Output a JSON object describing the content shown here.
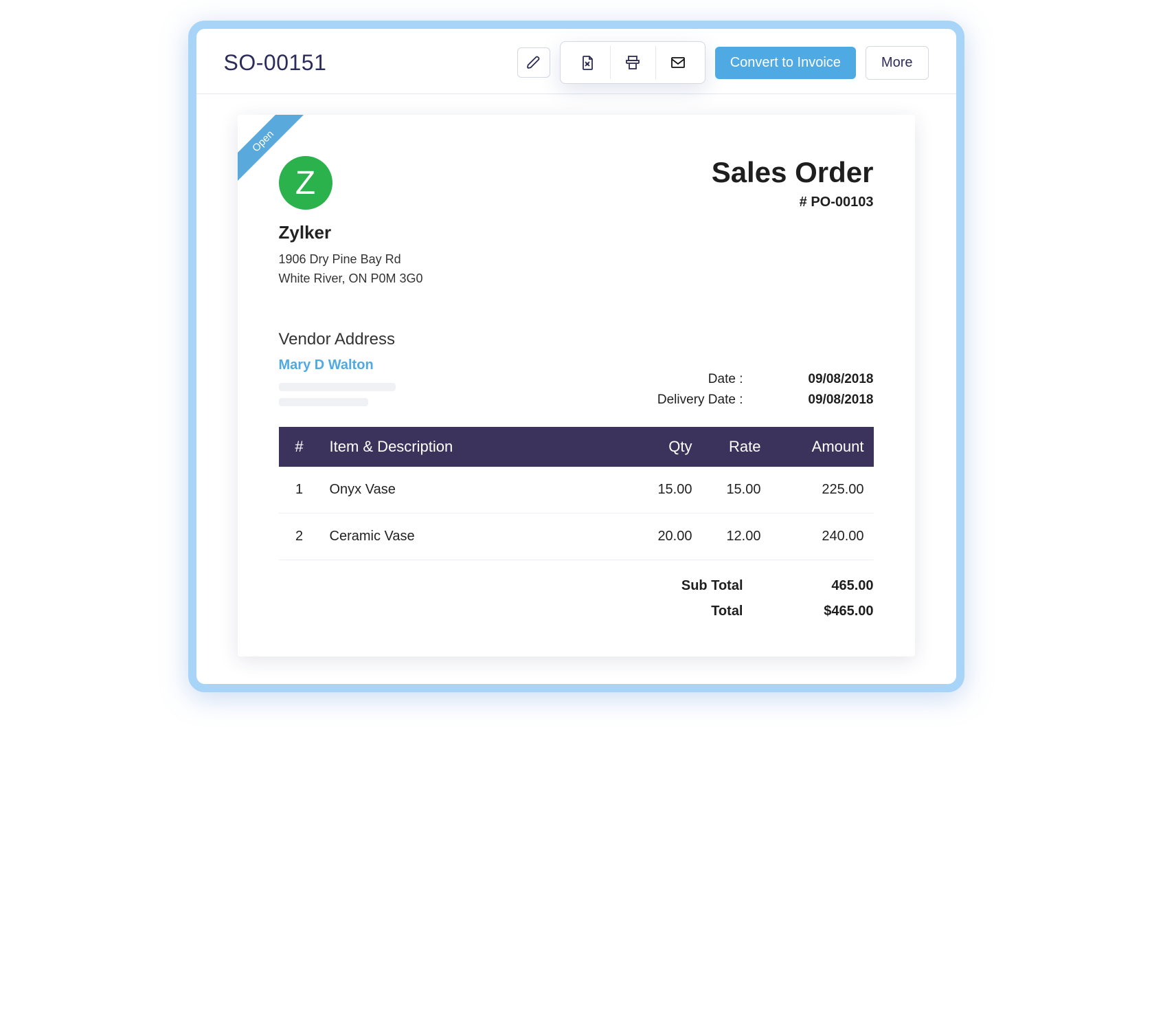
{
  "header": {
    "order_id": "SO-00151",
    "convert_label": "Convert to Invoice",
    "more_label": "More"
  },
  "ribbon": {
    "status": "Open"
  },
  "company": {
    "logo_letter": "Z",
    "name": "Zylker",
    "address_line1": "1906 Dry Pine Bay Rd",
    "address_line2": "White River, ON P0M 3G0"
  },
  "document": {
    "type_label": "Sales Order",
    "number": "# PO-00103"
  },
  "vendor": {
    "heading": "Vendor Address",
    "name": "Mary D Walton"
  },
  "meta": {
    "date_label": "Date :",
    "date_value": "09/08/2018",
    "delivery_label": "Delivery Date :",
    "delivery_value": "09/08/2018"
  },
  "columns": {
    "index": "#",
    "item": "Item & Description",
    "qty": "Qty",
    "rate": "Rate",
    "amount": "Amount"
  },
  "items": [
    {
      "idx": "1",
      "name": "Onyx Vase",
      "qty": "15.00",
      "rate": "15.00",
      "amount": "225.00"
    },
    {
      "idx": "2",
      "name": "Ceramic Vase",
      "qty": "20.00",
      "rate": "12.00",
      "amount": "240.00"
    }
  ],
  "totals": {
    "subtotal_label": "Sub Total",
    "subtotal_value": "465.00",
    "total_label": "Total",
    "total_value": "$465.00"
  }
}
